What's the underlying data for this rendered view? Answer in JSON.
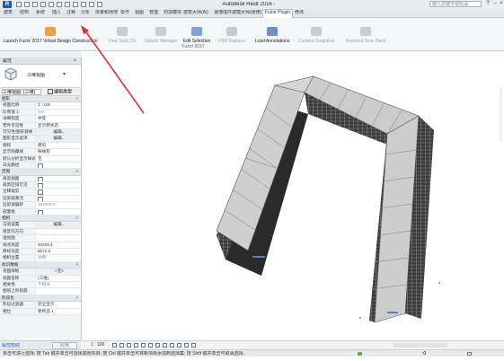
{
  "window": {
    "title": "Autodesk Revit 2016 -",
    "search_placeholder": "键入关键字或短语"
  },
  "menu_tabs": [
    "建筑",
    "结构",
    "系统",
    "插入",
    "注释",
    "分析",
    "体量和场地",
    "协作",
    "视图",
    "管理",
    "附加模块",
    "建筑大师(Ai)",
    "速博插件",
    "建模大师(通用)",
    "Fuzor Plugin",
    "修改"
  ],
  "active_tab_index": 14,
  "ribbon": {
    "buttons": [
      {
        "label": "Launch Fuzor 2017 Virtual Design Construction",
        "icon": "fuzor-launch-icon",
        "enabled": true
      },
      {
        "label": "View Sync On",
        "icon": "camera-sync-icon",
        "enabled": false
      },
      {
        "label": "Update Manager",
        "icon": "update-manager-icon",
        "enabled": false
      },
      {
        "label": "Edit Selection",
        "icon": "edit-selection-icon",
        "enabled": true
      },
      {
        "label": "FBX Replace",
        "icon": "fbx-replace-icon",
        "enabled": false
      },
      {
        "label": "Load Annotations",
        "icon": "load-annotations-icon",
        "enabled": true
      },
      {
        "label": "Camera Snapshot",
        "icon": "camera-snapshot-icon",
        "enabled": false
      },
      {
        "label": "Keyword Sync Back",
        "icon": "keyword-sync-icon",
        "enabled": false
      }
    ],
    "panel_label": "Fuzor 2017"
  },
  "properties": {
    "header": "属性",
    "type_name": "三维视图",
    "view_selector": "三维视图: {三维}",
    "edit_type": "编辑类型",
    "rows": [
      {
        "kind": "section",
        "key": "图形"
      },
      {
        "key": "视图比例",
        "value": "1 : 100"
      },
      {
        "key": "比例值 1:",
        "value": "100",
        "style": "grey"
      },
      {
        "key": "详细程度",
        "value": "中等"
      },
      {
        "key": "零件可见性",
        "value": "显示原状态"
      },
      {
        "key": "可见性/图形替换",
        "value": "编辑...",
        "style": "btn"
      },
      {
        "key": "图形显示选项",
        "value": "编辑...",
        "style": "btn"
      },
      {
        "key": "规程",
        "value": "建筑"
      },
      {
        "key": "显示隐藏线",
        "value": "按规程"
      },
      {
        "key": "默认分析显示样式",
        "value": "无"
      },
      {
        "key": "日光路径",
        "value": "",
        "style": "chk"
      },
      {
        "kind": "section",
        "key": "范围"
      },
      {
        "key": "裁剪视图",
        "value": "",
        "style": "chk"
      },
      {
        "key": "裁剪区域可见",
        "value": "",
        "style": "chk"
      },
      {
        "key": "注释裁剪",
        "value": "",
        "style": "chk"
      },
      {
        "key": "远剪裁激活",
        "value": "",
        "style": "chk"
      },
      {
        "key": "远剪裁偏移",
        "value": "304800.0",
        "style": "grey"
      },
      {
        "key": "剖面框",
        "value": "",
        "style": "chk"
      },
      {
        "kind": "section",
        "key": "相机"
      },
      {
        "key": "渲染设置",
        "value": "编辑...",
        "style": "btn"
      },
      {
        "key": "锁定的方向",
        "value": "",
        "style": "grey"
      },
      {
        "key": "透视图",
        "value": "",
        "style": "grey"
      },
      {
        "key": "视点高度",
        "value": "40208.4"
      },
      {
        "key": "目标高度",
        "value": "8572.6"
      },
      {
        "key": "相机位置",
        "value": "调整",
        "style": "grey"
      },
      {
        "kind": "section",
        "key": "标识数据"
      },
      {
        "key": "视图样板",
        "value": "<无>",
        "style": "btn"
      },
      {
        "key": "视图名称",
        "value": "{三维}"
      },
      {
        "key": "相关性",
        "value": "不相关",
        "style": "grey"
      },
      {
        "key": "图纸上的标题",
        "value": ""
      },
      {
        "kind": "section",
        "key": "阶段化"
      },
      {
        "key": "阶段过滤器",
        "value": "完全显示"
      },
      {
        "key": "相位",
        "value": "新构造 1"
      }
    ],
    "help_link": "属性帮助",
    "apply_label": "应用"
  },
  "view_control": {
    "scale": "1 : 100"
  },
  "status": {
    "text": "单击可进行选择; 按 Tab 键并单击可选择其他项目; 按 Ctrl 键并单击可将新项目添加到选择集; 按 Shift 键并单击可取消选择。",
    "right_value": ":0"
  },
  "colors": {
    "annotation_arrow": "#e0312f",
    "roof": "#cfcfcf",
    "facade": "#2c2c2c",
    "accent": "#2a5db0"
  }
}
